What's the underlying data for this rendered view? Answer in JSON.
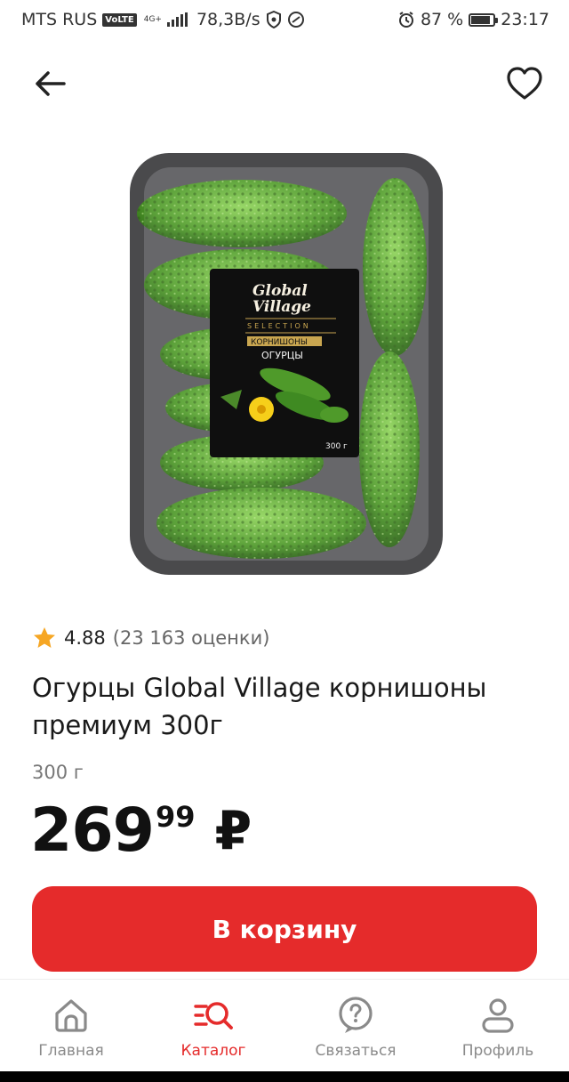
{
  "status_bar": {
    "carrier": "MTS RUS",
    "volte": "VoLTE",
    "network": "4G+",
    "speed": "78,3B/s",
    "battery": "87 %",
    "battery_level": 0.87,
    "time": "23:17"
  },
  "product": {
    "rating": "4.88",
    "ratings_count": "(23 163 оценки)",
    "title": "Огурцы Global Village корнишоны премиум 300г",
    "weight": "300 г",
    "price_int": "269",
    "price_kop": "99",
    "currency": "₽",
    "image": {
      "brand_line1": "Global",
      "brand_line2": "Village",
      "brand_sub": "SELECTION",
      "label_strip": "КОРНИШОНЫ",
      "label_name": "ОГУРЦЫ",
      "label_weight": "300 г"
    }
  },
  "cart_button": {
    "label": "В корзину"
  },
  "bottom_nav": [
    {
      "label": "Главная",
      "icon": "home-icon",
      "active": false
    },
    {
      "label": "Каталог",
      "icon": "catalog-search-icon",
      "active": true
    },
    {
      "label": "Связаться",
      "icon": "help-icon",
      "active": false
    },
    {
      "label": "Профиль",
      "icon": "profile-icon",
      "active": false
    }
  ],
  "colors": {
    "accent": "#e52b2b",
    "star": "#f6a623",
    "inactive": "#8a8a8a"
  }
}
